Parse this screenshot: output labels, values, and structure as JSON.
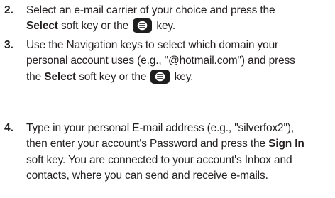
{
  "steps": [
    {
      "number": "2.",
      "lines": [
        {
          "pre": "Select an e-mail carrier of your choice and press the"
        },
        {
          "bold": "Select",
          "mid": " soft key or the ",
          "icon": "center-select-key-icon",
          "post": " key."
        }
      ]
    },
    {
      "number": "3.",
      "lines": [
        {
          "pre": "Use the Navigation keys to select which domain your"
        },
        {
          "pre": "personal account uses (e.g., \"@hotmail.com\") and press"
        },
        {
          "pre": "the ",
          "bold": "Select",
          "mid": " soft key or the ",
          "icon": "center-select-key-icon",
          "post": " key."
        }
      ]
    },
    {
      "number": "4.",
      "lines": [
        {
          "pre": "Type in your personal E-mail address (e.g., \"silverfox2\"),"
        },
        {
          "pre": "then enter your account's Password and press the ",
          "bold": "Sign In"
        },
        {
          "pre": "soft key. You are connected to your account's Inbox and"
        },
        {
          "pre": "contacts, where you can send and receive e-mails."
        }
      ]
    }
  ]
}
